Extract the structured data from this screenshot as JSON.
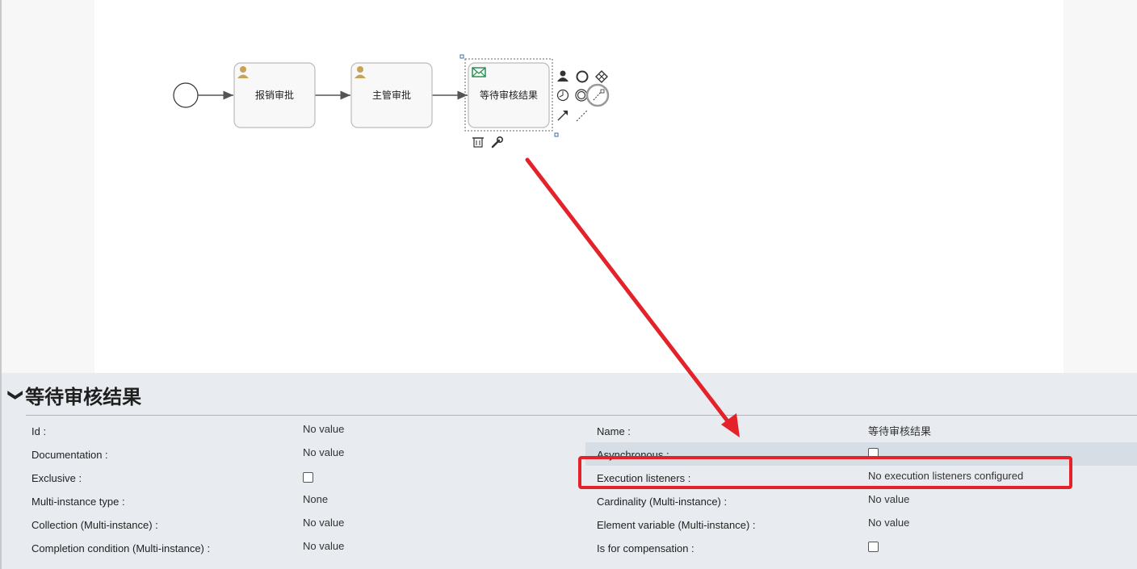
{
  "diagram": {
    "tasks": [
      {
        "label": "报销审批",
        "type": "user-task"
      },
      {
        "label": "主管审批",
        "type": "user-task"
      },
      {
        "label": "等待审核结果",
        "type": "receive-task",
        "selected": true
      }
    ],
    "icons": {
      "user": "user-icon",
      "envelope": "envelope-icon",
      "delete": "trash-icon",
      "configure": "wrench-icon"
    }
  },
  "properties": {
    "title": "等待审核结果",
    "left": [
      {
        "label": "Id :",
        "value": "No value"
      },
      {
        "label": "Documentation :",
        "value": "No value"
      },
      {
        "label": "Exclusive :",
        "value": ""
      },
      {
        "label": "Multi-instance type :",
        "value": "None"
      },
      {
        "label": "Collection (Multi-instance) :",
        "value": "No value"
      },
      {
        "label": "Completion condition (Multi-instance) :",
        "value": "No value"
      }
    ],
    "right": [
      {
        "label": "Name :",
        "value": "等待审核结果"
      },
      {
        "label": "Asynchronous :",
        "value": ""
      },
      {
        "label": "Execution listeners :",
        "value": "No execution listeners configured"
      },
      {
        "label": "Cardinality (Multi-instance) :",
        "value": "No value"
      },
      {
        "label": "Element variable (Multi-instance) :",
        "value": "No value"
      },
      {
        "label": "Is for compensation :",
        "value": ""
      }
    ]
  },
  "colors": {
    "annotation": "#e3222a",
    "task_fill": "#f8f8f8",
    "task_stroke": "#bbbbbb",
    "user_icon": "#c9a25a",
    "envelope_icon": "#1e8a4a",
    "panel_bg": "#e8ecf0"
  }
}
